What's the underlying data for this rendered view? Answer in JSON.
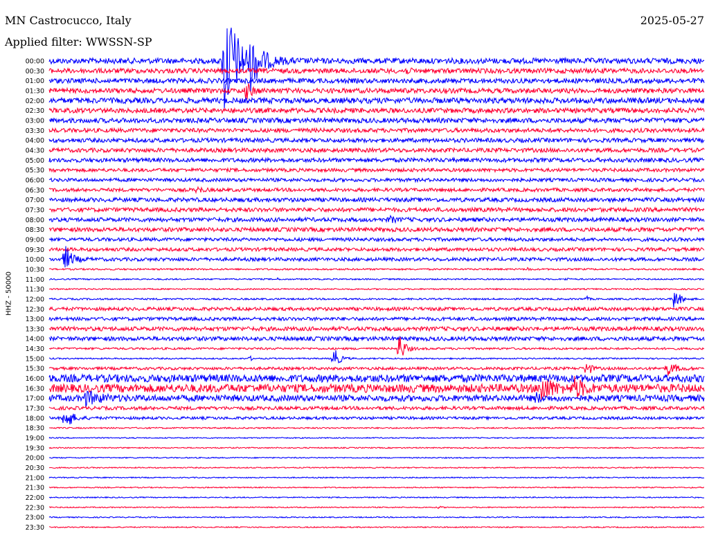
{
  "header": {
    "station": "MN Castrocucco, Italy",
    "filter_label": "Applied filter: WWSSN-SP",
    "date": "2025-05-27"
  },
  "chart_data": {
    "type": "line",
    "ylabel": "HHZ - 50000",
    "colors": {
      "even_rows": "#0000ff",
      "odd_rows": "#ff0033"
    },
    "row_labels": [
      "00:00",
      "00:30",
      "01:00",
      "01:30",
      "02:00",
      "02:30",
      "03:00",
      "03:30",
      "04:00",
      "04:30",
      "05:00",
      "05:30",
      "06:00",
      "06:30",
      "07:00",
      "07:30",
      "08:00",
      "08:30",
      "09:00",
      "09:30",
      "10:00",
      "10:30",
      "11:00",
      "11:30",
      "12:00",
      "12:30",
      "13:00",
      "13:30",
      "14:00",
      "14:30",
      "15:00",
      "15:30",
      "16:00",
      "16:30",
      "17:00",
      "17:30",
      "18:00",
      "18:30",
      "19:00",
      "19:30",
      "20:00",
      "20:30",
      "21:00",
      "21:30",
      "22:00",
      "22:30",
      "23:00",
      "23:30"
    ],
    "x_range_minutes": [
      0,
      30
    ],
    "noise_amplitude": [
      4,
      3.5,
      3.5,
      3.5,
      4,
      3.5,
      3.5,
      3,
      3,
      3,
      3,
      2.5,
      2.5,
      2.5,
      3,
      3,
      3,
      3,
      2.5,
      2.5,
      2.5,
      1.2,
      1,
      1,
      1.2,
      2.5,
      2.5,
      3,
      3,
      1.5,
      1,
      2,
      5.5,
      6,
      4.5,
      2.5,
      2,
      1,
      0.8,
      0.8,
      0.8,
      0.8,
      0.8,
      0.8,
      0.8,
      0.8,
      0.8,
      0.8
    ],
    "events": [
      {
        "row": 0,
        "minute": 8.0,
        "amplitude": 95,
        "decay": 4.0
      },
      {
        "row": 0,
        "minute": 9.2,
        "amplitude": 30,
        "decay": 3.0
      },
      {
        "row": 1,
        "minute": 16.3,
        "amplitude": 4,
        "decay": 1.0
      },
      {
        "row": 3,
        "minute": 9.0,
        "amplitude": 14,
        "decay": 1.5
      },
      {
        "row": 13,
        "minute": 6.8,
        "amplitude": 5,
        "decay": 1.2
      },
      {
        "row": 16,
        "minute": 15.6,
        "amplitude": 5,
        "decay": 1.2
      },
      {
        "row": 20,
        "minute": 0.7,
        "amplitude": 22,
        "decay": 1.8
      },
      {
        "row": 21,
        "minute": 21.9,
        "amplitude": 4,
        "decay": 0.5
      },
      {
        "row": 22,
        "minute": 10.4,
        "amplitude": 3,
        "decay": 0.4
      },
      {
        "row": 22,
        "minute": 23.7,
        "amplitude": 3,
        "decay": 0.4
      },
      {
        "row": 24,
        "minute": 24.6,
        "amplitude": 5,
        "decay": 0.5
      },
      {
        "row": 24,
        "minute": 28.6,
        "amplitude": 20,
        "decay": 1.5
      },
      {
        "row": 29,
        "minute": 16.0,
        "amplitude": 26,
        "decay": 1.5
      },
      {
        "row": 30,
        "minute": 9.2,
        "amplitude": 4,
        "decay": 0.5
      },
      {
        "row": 30,
        "minute": 13.0,
        "amplitude": 20,
        "decay": 1.5
      },
      {
        "row": 31,
        "minute": 24.6,
        "amplitude": 18,
        "decay": 1.0
      },
      {
        "row": 31,
        "minute": 28.3,
        "amplitude": 10,
        "decay": 2.5
      },
      {
        "row": 33,
        "minute": 22.5,
        "amplitude": 20,
        "decay": 3.0
      },
      {
        "row": 33,
        "minute": 24.0,
        "amplitude": 16,
        "decay": 2.5
      },
      {
        "row": 34,
        "minute": 1.6,
        "amplitude": 10,
        "decay": 4.0
      },
      {
        "row": 34,
        "minute": 22.3,
        "amplitude": 8,
        "decay": 1.0
      },
      {
        "row": 36,
        "minute": 0.7,
        "amplitude": 22,
        "decay": 1.8
      },
      {
        "row": 45,
        "minute": 17.9,
        "amplitude": 3,
        "decay": 0.3
      }
    ]
  }
}
